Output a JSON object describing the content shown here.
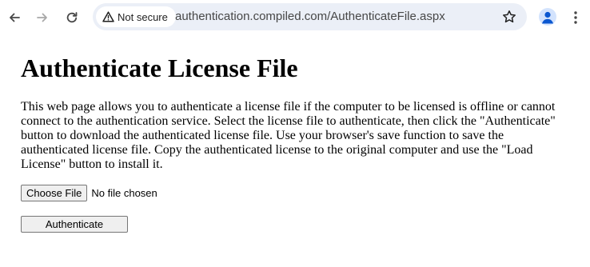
{
  "browser": {
    "security_label": "Not secure",
    "url": "authentication.compiled.com/AuthenticateFile.aspx",
    "icons": {
      "back": "arrow-left-icon",
      "forward": "arrow-right-icon",
      "reload": "reload-icon",
      "security": "warning-triangle-icon",
      "bookmark": "star-icon",
      "profile": "profile-avatar-icon",
      "menu": "kebab-menu-icon"
    },
    "colors": {
      "omnibox_bg": "#ebeff7",
      "profile_accent": "#0b57d0"
    }
  },
  "page": {
    "title": "Authenticate License File",
    "description": "This web page allows you to authenticate a license file if the computer to be licensed is offline or cannot connect to the authentication service. Select the license file to authenticate, then click the \"Authenticate\" button to download the authenticated license file. Use your browser's save function to save the authenticated license file. Copy the authenticated license to the original computer and use the \"Load License\" button to install it.",
    "file_input": {
      "button_label": "Choose File",
      "status": "No file chosen"
    },
    "authenticate_label": "Authenticate"
  }
}
